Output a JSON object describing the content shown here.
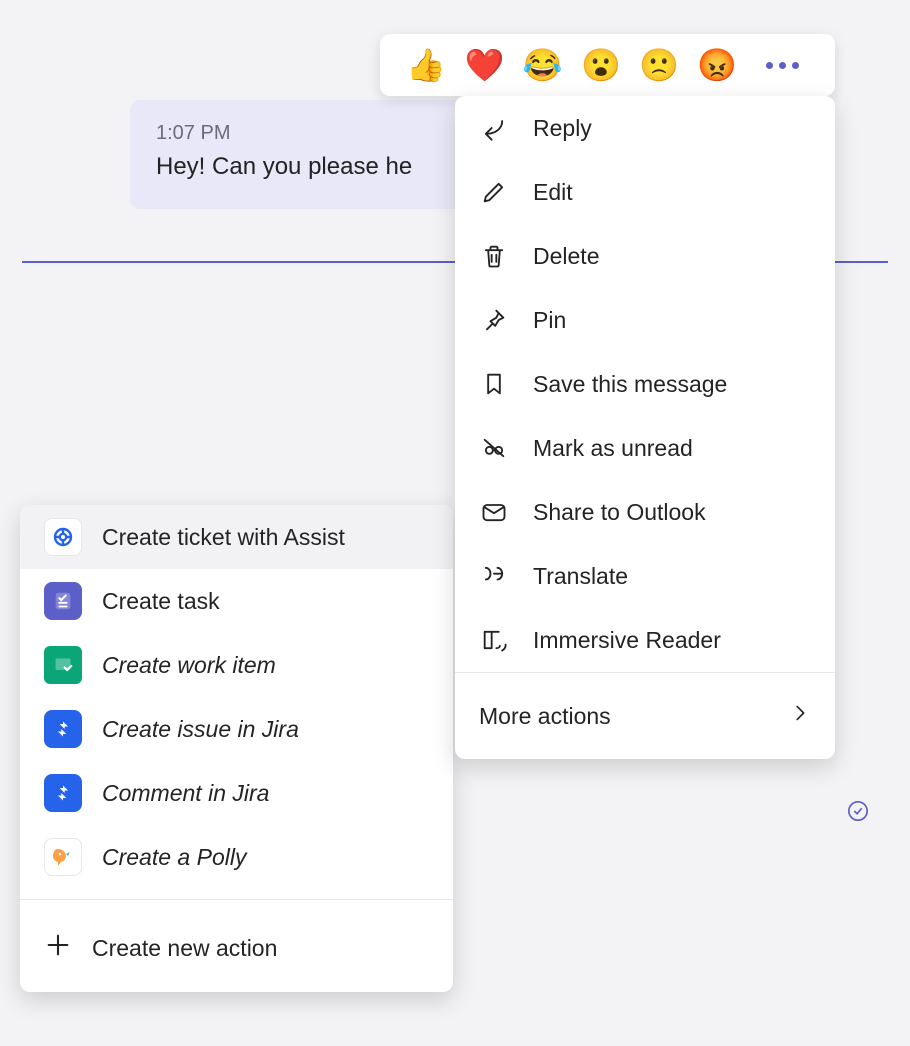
{
  "message": {
    "time": "1:07 PM",
    "text": "Hey! Can you please he"
  },
  "reactions": {
    "emojis": [
      "👍",
      "❤️",
      "😂",
      "😮",
      "🙁",
      "😡"
    ]
  },
  "context_menu": {
    "items": [
      {
        "label": "Reply",
        "icon": "reply-icon"
      },
      {
        "label": "Edit",
        "icon": "edit-pencil-icon"
      },
      {
        "label": "Delete",
        "icon": "trash-icon"
      },
      {
        "label": "Pin",
        "icon": "pin-icon"
      },
      {
        "label": "Save this message",
        "icon": "bookmark-icon"
      },
      {
        "label": "Mark as unread",
        "icon": "glasses-off-icon"
      },
      {
        "label": "Share to Outlook",
        "icon": "mail-icon"
      },
      {
        "label": "Translate",
        "icon": "translate-icon"
      },
      {
        "label": "Immersive Reader",
        "icon": "immersive-reader-icon"
      }
    ],
    "more_label": "More actions"
  },
  "submenu": {
    "items": [
      {
        "label": "Create ticket with Assist",
        "icon_class": "ic-assist",
        "highlight": true,
        "italic": false
      },
      {
        "label": "Create task",
        "icon_class": "ic-task",
        "highlight": false,
        "italic": false
      },
      {
        "label": "Create work item",
        "icon_class": "ic-work",
        "highlight": false,
        "italic": true
      },
      {
        "label": "Create issue in Jira",
        "icon_class": "ic-jira",
        "highlight": false,
        "italic": true
      },
      {
        "label": "Comment in Jira",
        "icon_class": "ic-jira",
        "highlight": false,
        "italic": true
      },
      {
        "label": "Create a Polly",
        "icon_class": "ic-polly",
        "highlight": false,
        "italic": true
      }
    ],
    "new_action_label": "Create new action"
  }
}
